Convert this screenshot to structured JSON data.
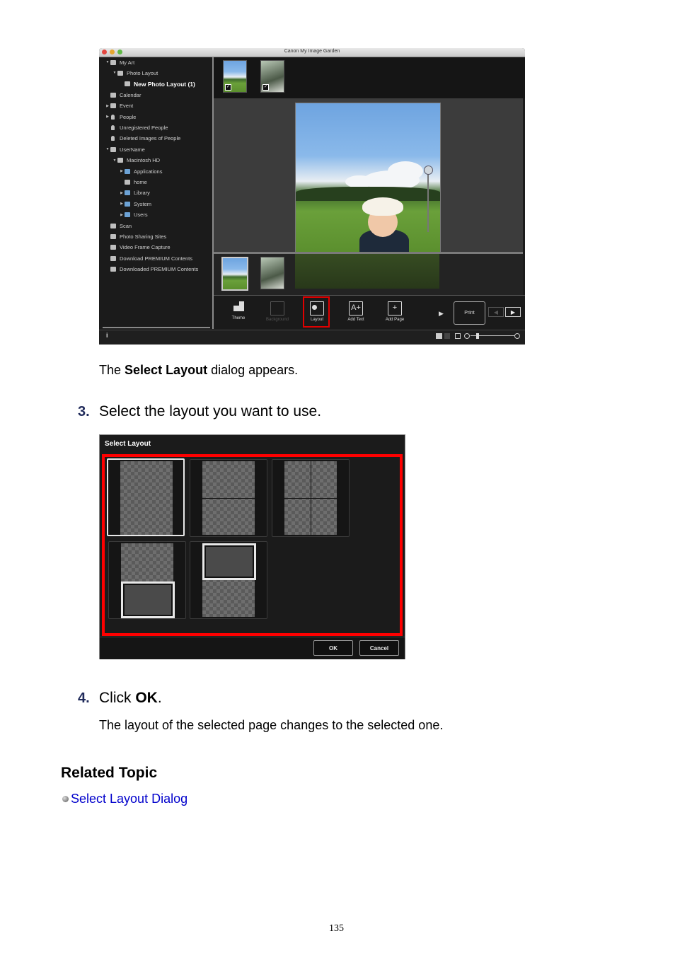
{
  "app": {
    "title": "Canon My Image Garden",
    "sidebar": [
      {
        "label": "My Art",
        "indent": 0,
        "arrow": "down",
        "icon": "my-art"
      },
      {
        "label": "Photo Layout",
        "indent": 1,
        "arrow": "down",
        "icon": "layout"
      },
      {
        "label": "New Photo Layout (1)",
        "indent": 2,
        "arrow": "",
        "icon": "layout",
        "selected": true
      },
      {
        "label": "Calendar",
        "indent": 0,
        "arrow": "",
        "icon": "calendar"
      },
      {
        "label": "Event",
        "indent": 0,
        "arrow": "right",
        "icon": "event"
      },
      {
        "label": "People",
        "indent": 0,
        "arrow": "right",
        "icon": "person"
      },
      {
        "label": "Unregistered People",
        "indent": 0,
        "arrow": "",
        "icon": "person"
      },
      {
        "label": "Deleted Images of People",
        "indent": 0,
        "arrow": "",
        "icon": "person"
      },
      {
        "label": "UserName",
        "indent": 0,
        "arrow": "down",
        "icon": "computer"
      },
      {
        "label": "Macintosh HD",
        "indent": 1,
        "arrow": "down",
        "icon": "disk"
      },
      {
        "label": "Applications",
        "indent": 2,
        "arrow": "right",
        "icon": "folder"
      },
      {
        "label": "home",
        "indent": 2,
        "arrow": "",
        "icon": "home"
      },
      {
        "label": "Library",
        "indent": 2,
        "arrow": "right",
        "icon": "folder"
      },
      {
        "label": "System",
        "indent": 2,
        "arrow": "right",
        "icon": "folder"
      },
      {
        "label": "Users",
        "indent": 2,
        "arrow": "right",
        "icon": "folder"
      },
      {
        "label": "Scan",
        "indent": 0,
        "arrow": "",
        "icon": "scan"
      },
      {
        "label": "Photo Sharing Sites",
        "indent": 0,
        "arrow": "",
        "icon": "sharing"
      },
      {
        "label": "Video Frame Capture",
        "indent": 0,
        "arrow": "",
        "icon": "video"
      },
      {
        "label": "Download PREMIUM Contents",
        "indent": 0,
        "arrow": "",
        "icon": "download"
      },
      {
        "label": "Downloaded PREMIUM Contents",
        "indent": 0,
        "arrow": "",
        "icon": "folder-gray"
      }
    ],
    "toolbar": {
      "theme": "Theme",
      "background": "Background",
      "layout": "Layout",
      "add_text": "Add Text",
      "add_page": "Add Page",
      "print": "Print"
    },
    "checkmark": "✓",
    "info_icon": "i",
    "more_arrow": "▶",
    "prev_arrow": "◀",
    "next_arrow": "▶"
  },
  "caption_1": {
    "prefix": "The ",
    "bold": "Select Layout",
    "suffix": " dialog appears."
  },
  "step_3": {
    "number": "3.",
    "text": "Select the layout you want to use."
  },
  "dialog": {
    "title": "Select Layout",
    "ok": "OK",
    "cancel": "Cancel",
    "layouts": [
      {
        "name": "single-photo",
        "selected": true
      },
      {
        "name": "two-horizontal"
      },
      {
        "name": "four-grid"
      },
      {
        "name": "photo-bottom-framed"
      },
      {
        "name": "photo-top-framed"
      }
    ]
  },
  "step_4": {
    "number": "4.",
    "prefix": "Click ",
    "bold": "OK",
    "suffix": "."
  },
  "step_4_desc": "The layout of the selected page changes to the selected one.",
  "related": {
    "heading": "Related Topic",
    "links": [
      {
        "label": "Select Layout Dialog"
      }
    ]
  },
  "page_number": "135"
}
